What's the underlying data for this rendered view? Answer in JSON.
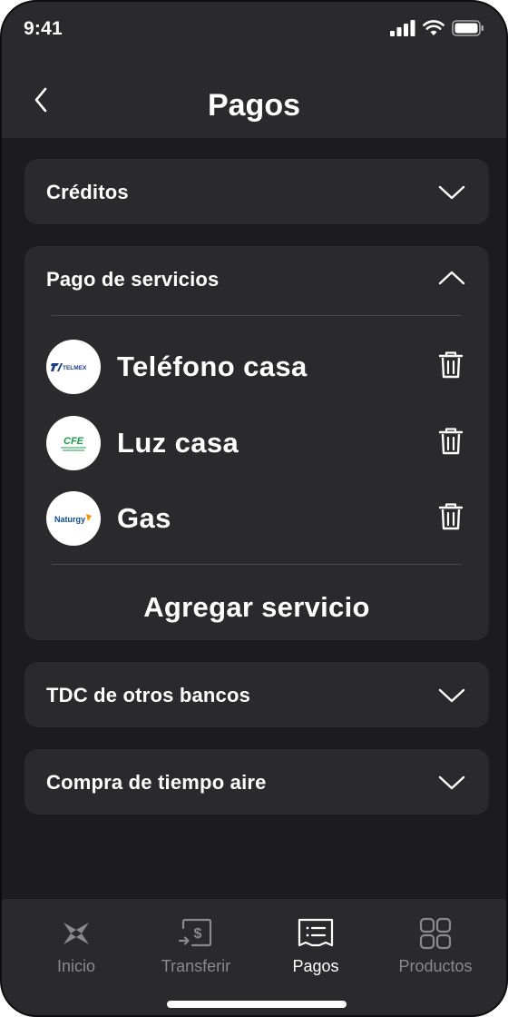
{
  "status_bar": {
    "time": "9:41"
  },
  "header": {
    "title": "Pagos",
    "back_icon": "chevron-left-icon"
  },
  "sections": {
    "creditos": {
      "title": "Créditos",
      "expanded": false
    },
    "pago_servicios": {
      "title": "Pago de servicios",
      "expanded": true,
      "services": [
        {
          "name": "Teléfono casa",
          "logo_text": "TELMEX",
          "logo_color": "#1f3c88"
        },
        {
          "name": "Luz casa",
          "logo_text": "CFE",
          "logo_color": "#1a9e4b"
        },
        {
          "name": "Gas",
          "logo_text": "Naturgy",
          "logo_color": "#0b4a8b"
        }
      ],
      "add_label": "Agregar servicio"
    },
    "tdc": {
      "title": "TDC de otros bancos",
      "expanded": false
    },
    "tiempo_aire": {
      "title": "Compra de tiempo aire",
      "expanded": false
    }
  },
  "tabbar": {
    "tabs": [
      {
        "label": "Inicio",
        "icon": "home-logo-icon",
        "active": false
      },
      {
        "label": "Transferir",
        "icon": "transfer-icon",
        "active": false
      },
      {
        "label": "Pagos",
        "icon": "receipt-icon",
        "active": true
      },
      {
        "label": "Productos",
        "icon": "grid-icon",
        "active": false
      }
    ]
  },
  "colors": {
    "background": "#1c1c1e",
    "card": "#2a2a2c",
    "text": "#ffffff",
    "inactive": "#8a8a8e"
  }
}
